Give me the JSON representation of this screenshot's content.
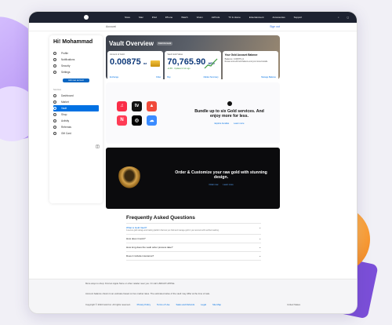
{
  "topbar": {
    "nav": [
      "Store",
      "Mac",
      "iPad",
      "iPhone",
      "Watch",
      "Vision",
      "AirPods",
      "TV & Home",
      "Entertainment",
      "Accessories",
      "Support"
    ],
    "right_icons": [
      "search-icon",
      "bag-icon"
    ]
  },
  "subbar": {
    "left": "Account",
    "right": "Sign out"
  },
  "sidebar": {
    "greeting": "Hi! Mohammad",
    "items": [
      {
        "label": "Profile",
        "icon": "user-icon"
      },
      {
        "label": "Notifications",
        "icon": "bell-icon"
      },
      {
        "label": "Security",
        "icon": "shield-icon"
      },
      {
        "label": "Settings",
        "icon": "gear-icon"
      }
    ],
    "button": "Add new account",
    "section_label": "Services",
    "services": [
      {
        "label": "Dashboard",
        "icon": "grid-icon"
      },
      {
        "label": "Market",
        "icon": "chart-icon"
      },
      {
        "label": "Vault",
        "icon": "vault-icon",
        "active": true
      },
      {
        "label": "Shop",
        "icon": "bag-icon"
      },
      {
        "label": "Activity",
        "icon": "clock-icon"
      },
      {
        "label": "Referrals",
        "icon": "gift-icon"
      },
      {
        "label": "Gift Card",
        "icon": "card-icon"
      }
    ],
    "collapse_icon": "sidebar-toggle-icon"
  },
  "hero": {
    "title": "Vault Overview",
    "badge": "Gold Account",
    "cards": [
      {
        "label": "Amount of Gold",
        "value": "0.00875",
        "unit": "oz",
        "links": [
          "Exchange",
          "Order"
        ]
      },
      {
        "label": "Vault Gold Value",
        "value": "70,765.90",
        "unit": "AED",
        "meta": "+0.8%  ·  Updated 2 min ago",
        "links": [
          "Buy",
          "Market Summary"
        ]
      },
      {
        "label": "Your Gold Account Balance",
        "value": "",
        "detail": "Balance: 0.00875 oz",
        "note": "Review and edit Gold balance and your stored details.",
        "links": [
          "Manage Balance"
        ]
      }
    ]
  },
  "bundle": {
    "apps": [
      {
        "name": "music-icon",
        "glyph": "♫",
        "color": "#fa2d48"
      },
      {
        "name": "tv-icon",
        "glyph": "tv",
        "color": "#111111"
      },
      {
        "name": "arcade-icon",
        "glyph": "▲",
        "color": "#f04a3a"
      },
      {
        "name": "news-icon",
        "glyph": "N",
        "color": "#ff3b55"
      },
      {
        "name": "fitness-icon",
        "glyph": "◎",
        "color": "#000000"
      },
      {
        "name": "icloud-icon",
        "glyph": "☁",
        "color": "#3a8bff"
      }
    ],
    "heading": "Bundle up to six Gold services. And enjoy more for less.",
    "links": [
      "Explore bundles",
      "Learn more"
    ]
  },
  "promo": {
    "heading": "Order & Customize your raw gold with stunning design.",
    "links": [
      "Order now",
      "Learn more"
    ]
  },
  "faq": {
    "title": "Frequently Asked Questions",
    "items": [
      {
        "q": "What is Gold Vault?",
        "a": "A secure gold storage and trading platform that lets you hold and manage gold in your account with certified vaulting."
      },
      {
        "q": "How does it work?",
        "a": ""
      },
      {
        "q": "How long does the vault order process take?",
        "a": ""
      },
      {
        "q": "Does it include insurance?",
        "a": ""
      }
    ]
  },
  "footer": {
    "help": "More ways to shop: Find an Apple Store or other retailer near you. Or call 1-800-MY-APPLE.",
    "legal": "Account balance shown is an estimate based on live market rates. The estimated value of the vault may differ at the time of sale.",
    "copyright": "Copyright © 2024 Gold Inc. All rights reserved.",
    "links": [
      "Privacy Policy",
      "Terms of Use",
      "Sales and Refunds",
      "Legal",
      "Site Map"
    ],
    "region": "United States"
  }
}
